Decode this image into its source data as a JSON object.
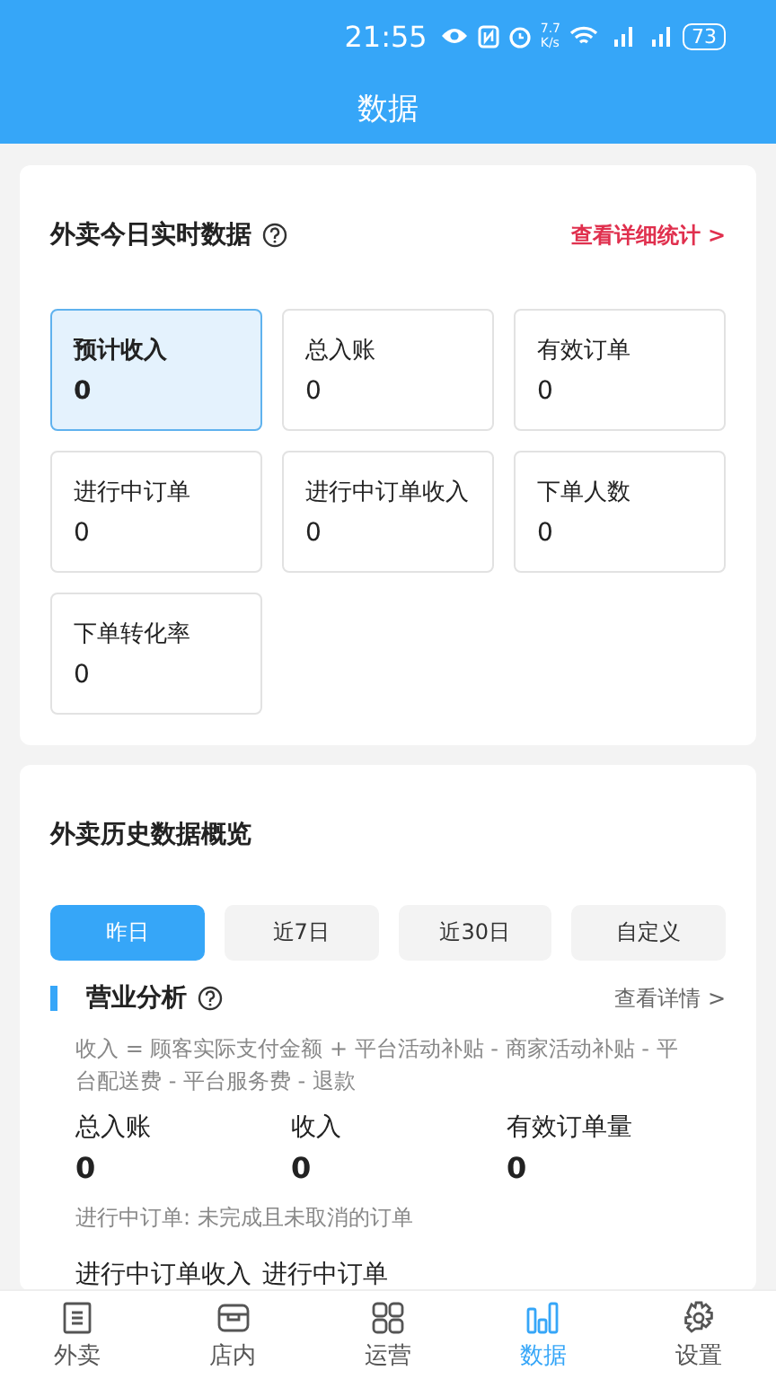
{
  "status_bar": {
    "time": "21:55",
    "speed": "7.7",
    "speed_unit": "K/s",
    "battery": "73"
  },
  "header": {
    "title": "数据"
  },
  "realtime": {
    "title": "外卖今日实时数据",
    "link": "查看详细统计 >",
    "metrics": [
      {
        "label": "预计收入",
        "value": "0",
        "selected": true
      },
      {
        "label": "总入账",
        "value": "0",
        "selected": false
      },
      {
        "label": "有效订单",
        "value": "0",
        "selected": false
      },
      {
        "label": "进行中订单",
        "value": "0",
        "selected": false
      },
      {
        "label": "进行中订单收入",
        "value": "0",
        "selected": false
      },
      {
        "label": "下单人数",
        "value": "0",
        "selected": false
      },
      {
        "label": "下单转化率",
        "value": "0",
        "selected": false
      }
    ]
  },
  "history": {
    "title": "外卖历史数据概览",
    "ranges": [
      {
        "label": "昨日",
        "selected": true
      },
      {
        "label": "近7日",
        "selected": false
      },
      {
        "label": "近30日",
        "selected": false
      },
      {
        "label": "自定义",
        "selected": false
      }
    ],
    "section": {
      "title": "营业分析",
      "link": "查看详情 >",
      "formula": "收入 = 顾客实际支付金额 + 平台活动补贴 - 商家活动补贴 - 平台配送费 - 平台服务费 - 退款",
      "stats": [
        {
          "label": "总入账",
          "value": "0"
        },
        {
          "label": "收入",
          "value": "0"
        },
        {
          "label": "有效订单量",
          "value": "0"
        }
      ],
      "note": "进行中订单: 未完成且未取消的订单",
      "more_labels": [
        "进行中订单收入",
        "进行中订单"
      ]
    }
  },
  "tab_bar": [
    {
      "label": "外卖",
      "selected": false
    },
    {
      "label": "店内",
      "selected": false
    },
    {
      "label": "运营",
      "selected": false
    },
    {
      "label": "数据",
      "selected": true
    },
    {
      "label": "设置",
      "selected": false
    }
  ]
}
